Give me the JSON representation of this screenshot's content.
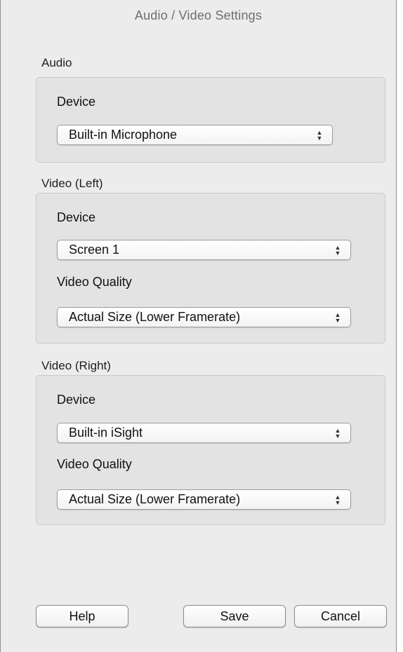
{
  "window": {
    "title": "Audio / Video Settings"
  },
  "audio": {
    "group_label": "Audio",
    "device_label": "Device",
    "device_value": "Built-in Microphone"
  },
  "video_left": {
    "group_label": "Video (Left)",
    "device_label": "Device",
    "device_value": "Screen 1",
    "quality_label": "Video Quality",
    "quality_value": "Actual Size (Lower Framerate)"
  },
  "video_right": {
    "group_label": "Video (Right)",
    "device_label": "Device",
    "device_value": "Built-in iSight",
    "quality_label": "Video Quality",
    "quality_value": "Actual Size (Lower Framerate)"
  },
  "buttons": {
    "help": "Help",
    "save": "Save",
    "cancel": "Cancel"
  },
  "icons": {
    "popup_arrows": "up-down-chevron-icon"
  }
}
